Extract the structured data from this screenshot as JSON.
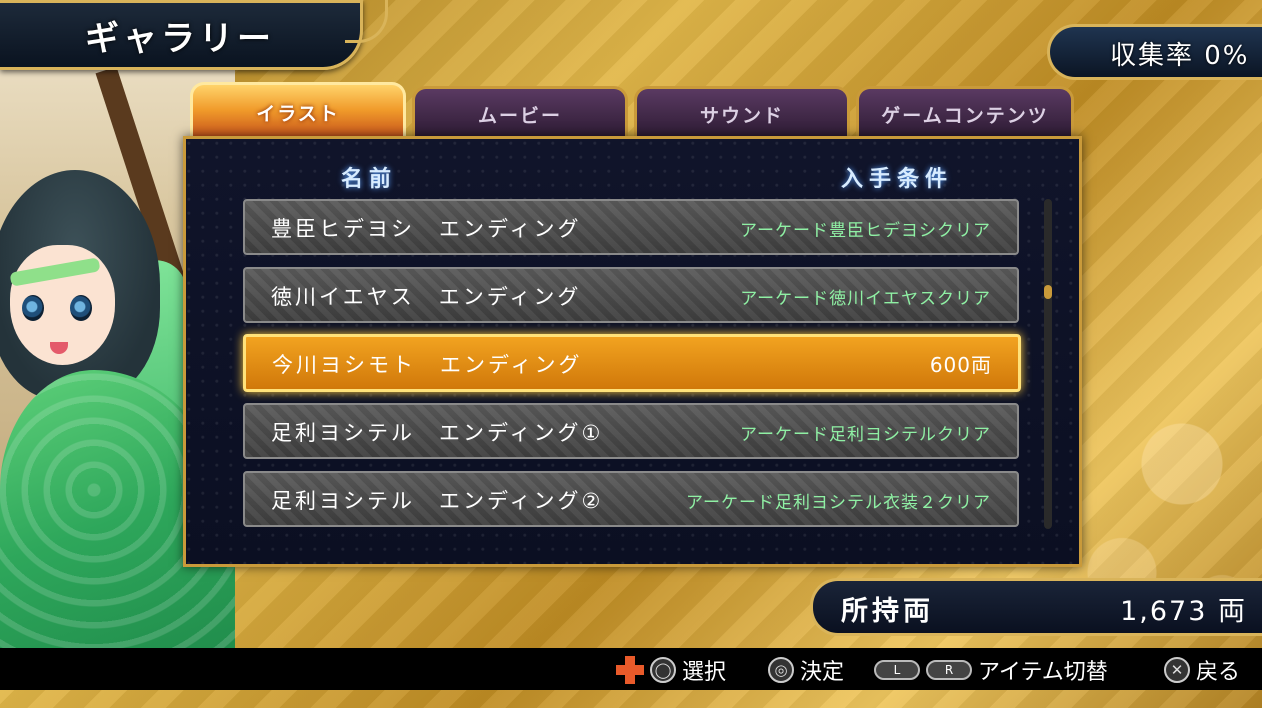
{
  "title": "ギャラリー",
  "collection_rate": "収集率 0%",
  "tabs": [
    {
      "label": "イラスト",
      "active": true
    },
    {
      "label": "ムービー",
      "active": false
    },
    {
      "label": "サウンド",
      "active": false
    },
    {
      "label": "ゲームコンテンツ",
      "active": false
    }
  ],
  "headers": {
    "name": "名前",
    "condition": "入手条件"
  },
  "items": [
    {
      "name": "豊臣ヒデヨシ　エンディング",
      "condition": "アーケード豊臣ヒデヨシクリア",
      "selected": false
    },
    {
      "name": "徳川イエヤス　エンディング",
      "condition": "アーケード徳川イエヤスクリア",
      "selected": false
    },
    {
      "name": "今川ヨシモト　エンディング",
      "condition": "600両",
      "selected": true
    },
    {
      "name": "足利ヨシテル　エンディング①",
      "condition": "アーケード足利ヨシテルクリア",
      "selected": false
    },
    {
      "name": "足利ヨシテル　エンディング②",
      "condition": "アーケード足利ヨシテル衣装２クリア",
      "selected": false
    }
  ],
  "money": {
    "label": "所持両",
    "value": "1,673 両"
  },
  "controls": {
    "select": "選択",
    "confirm": "決定",
    "switch_item": "アイテム切替",
    "back": "戻る",
    "l_button": "L",
    "r_button": "R",
    "circle": "◎",
    "cross": "✕",
    "analog": "◯"
  },
  "colors": {
    "accent_gold": "#d9b45a",
    "selected_row": "#f2a320",
    "condition_text": "#8ff0a4"
  }
}
